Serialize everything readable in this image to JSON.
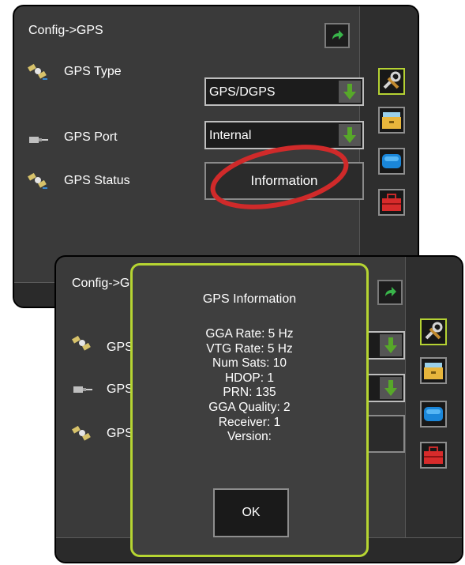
{
  "screen_a": {
    "title": "Config->GPS",
    "back_icon": "back-arrow-icon",
    "rows": [
      {
        "label": "GPS Type",
        "icon": "satellite-icon",
        "value": "GPS/DGPS"
      },
      {
        "label": "GPS Port",
        "icon": "port-connector-icon",
        "value": "Internal"
      },
      {
        "label": "GPS Status",
        "icon": "satellite-icon",
        "button": "Information"
      }
    ],
    "side_buttons": [
      "tools-icon",
      "file-cabinet-icon",
      "console-icon",
      "toolbox-icon"
    ],
    "callout_color": "#d02a2a"
  },
  "screen_b": {
    "title": "Config->G",
    "rows": [
      {
        "label": "GPS",
        "icon": "satellite-icon"
      },
      {
        "label": "GPS",
        "icon": "port-connector-icon"
      },
      {
        "label": "GPS",
        "icon": "satellite-icon"
      }
    ],
    "side_buttons": [
      "tools-icon",
      "file-cabinet-icon",
      "console-icon",
      "toolbox-icon"
    ]
  },
  "modal": {
    "title": "GPS Information",
    "lines": [
      "GGA Rate: 5 Hz",
      "VTG Rate: 5 Hz",
      "Num Sats: 10",
      "HDOP: 1",
      "PRN: 135",
      "GGA Quality: 2",
      "Receiver: 1",
      "Version:"
    ],
    "ok_label": "OK",
    "border_color": "#b6d532"
  },
  "colors": {
    "accent_green": "#b6d532",
    "arrow_green": "#57a829",
    "panel_bg": "#3a3a3a"
  }
}
